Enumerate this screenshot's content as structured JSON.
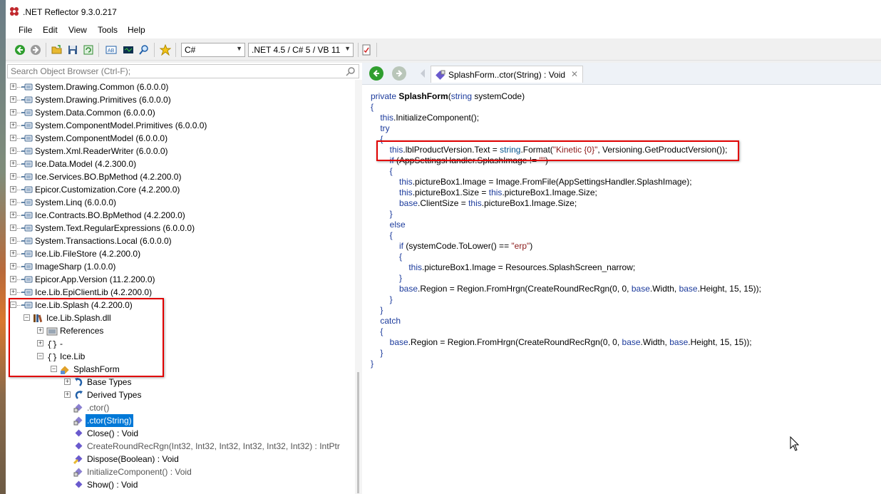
{
  "window": {
    "title": ".NET Reflector 9.3.0.217"
  },
  "menu": [
    "File",
    "Edit",
    "View",
    "Tools",
    "Help"
  ],
  "toolbar": {
    "language": "C#",
    "framework": ".NET 4.5 / C# 5 / VB 11",
    "icons": [
      "back-icon",
      "forward-icon",
      "open-icon",
      "save-icon",
      "refresh-icon",
      "analyzer-icon",
      "disassembler-icon",
      "search-icon",
      "bookmark-icon",
      "report-icon"
    ]
  },
  "search": {
    "placeholder": "Search Object Browser (Ctrl-F);"
  },
  "tree": [
    {
      "label": "System.Drawing.Common (6.0.0.0)",
      "level": 0,
      "icon": "assembly-icon",
      "expander": "+"
    },
    {
      "label": "System.Drawing.Primitives (6.0.0.0)",
      "level": 0,
      "icon": "assembly-icon",
      "expander": "+"
    },
    {
      "label": "System.Data.Common (6.0.0.0)",
      "level": 0,
      "icon": "assembly-icon",
      "expander": "+"
    },
    {
      "label": "System.ComponentModel.Primitives (6.0.0.0)",
      "level": 0,
      "icon": "assembly-icon",
      "expander": "+"
    },
    {
      "label": "System.ComponentModel (6.0.0.0)",
      "level": 0,
      "icon": "assembly-icon",
      "expander": "+"
    },
    {
      "label": "System.Xml.ReaderWriter (6.0.0.0)",
      "level": 0,
      "icon": "assembly-icon",
      "expander": "+"
    },
    {
      "label": "Ice.Data.Model (4.2.300.0)",
      "level": 0,
      "icon": "assembly-icon",
      "expander": "+"
    },
    {
      "label": "Ice.Services.BO.BpMethod (4.2.200.0)",
      "level": 0,
      "icon": "assembly-icon",
      "expander": "+"
    },
    {
      "label": "Epicor.Customization.Core (4.2.200.0)",
      "level": 0,
      "icon": "assembly-icon",
      "expander": "+"
    },
    {
      "label": "System.Linq (6.0.0.0)",
      "level": 0,
      "icon": "assembly-icon",
      "expander": "+"
    },
    {
      "label": "Ice.Contracts.BO.BpMethod (4.2.200.0)",
      "level": 0,
      "icon": "assembly-icon",
      "expander": "+"
    },
    {
      "label": "System.Text.RegularExpressions (6.0.0.0)",
      "level": 0,
      "icon": "assembly-icon",
      "expander": "+"
    },
    {
      "label": "System.Transactions.Local (6.0.0.0)",
      "level": 0,
      "icon": "assembly-icon",
      "expander": "+"
    },
    {
      "label": "Ice.Lib.FileStore (4.2.200.0)",
      "level": 0,
      "icon": "assembly-icon",
      "expander": "+"
    },
    {
      "label": "ImageSharp (1.0.0.0)",
      "level": 0,
      "icon": "assembly-icon",
      "expander": "+"
    },
    {
      "label": "Epicor.App.Version (11.2.200.0)",
      "level": 0,
      "icon": "assembly-icon",
      "expander": "+"
    },
    {
      "label": "Ice.Lib.EpiClientLib (4.2.200.0)",
      "level": 0,
      "icon": "assembly-icon",
      "expander": "+"
    },
    {
      "label": "Ice.Lib.Splash (4.2.200.0)",
      "level": 0,
      "icon": "assembly-icon",
      "expander": "-"
    },
    {
      "label": "Ice.Lib.Splash.dll",
      "level": 1,
      "icon": "module-icon",
      "expander": "-"
    },
    {
      "label": "References",
      "level": 2,
      "icon": "references-icon",
      "expander": "+"
    },
    {
      "label": "-",
      "level": 2,
      "icon": "namespace-icon",
      "expander": "+"
    },
    {
      "label": "Ice.Lib",
      "level": 2,
      "icon": "namespace-icon",
      "expander": "-"
    },
    {
      "label": "SplashForm",
      "level": 3,
      "icon": "class-icon",
      "expander": "-"
    },
    {
      "label": "Base Types",
      "level": 4,
      "icon": "base-types-icon",
      "expander": "+"
    },
    {
      "label": "Derived Types",
      "level": 4,
      "icon": "derived-types-icon",
      "expander": "+"
    },
    {
      "label": ".ctor()",
      "level": 4,
      "icon": "private-method-icon",
      "expander": "",
      "style": "gray"
    },
    {
      "label": ".ctor(String)",
      "level": 4,
      "icon": "private-method-icon",
      "expander": "",
      "style": "selected"
    },
    {
      "label": "Close() : Void",
      "level": 4,
      "icon": "method-icon",
      "expander": ""
    },
    {
      "label": "CreateRoundRecRgn(Int32, Int32, Int32, Int32, Int32, Int32) : IntPtr",
      "level": 4,
      "icon": "method-icon",
      "expander": "",
      "style": "gray"
    },
    {
      "label": "Dispose(Boolean) : Void",
      "level": 4,
      "icon": "protected-method-icon",
      "expander": ""
    },
    {
      "label": "InitializeComponent() : Void",
      "level": 4,
      "icon": "private-method-icon",
      "expander": "",
      "style": "gray"
    },
    {
      "label": "Show() : Void",
      "level": 4,
      "icon": "method-icon",
      "expander": ""
    }
  ],
  "document_tab": {
    "title": "SplashForm..ctor(String) : Void",
    "close": "✕"
  },
  "code_lines": [
    [
      [
        "kw",
        "private "
      ],
      [
        "bold",
        "SplashForm"
      ],
      [
        "",
        "("
      ],
      [
        "kw",
        "string"
      ],
      [
        "",
        " systemCode)"
      ]
    ],
    [
      [
        "kw",
        "{"
      ]
    ],
    [
      [
        "kw",
        "    this"
      ],
      [
        "",
        ".InitializeComponent();"
      ]
    ],
    [
      [
        "kw",
        "    try"
      ]
    ],
    [
      [
        "kw",
        "    {"
      ]
    ],
    [
      [
        "kw",
        "        this"
      ],
      [
        "",
        ".lblProductVersion.Text = "
      ],
      [
        "ty",
        "string"
      ],
      [
        "",
        ".Format("
      ],
      [
        "st",
        "\"Kinetic {0}\""
      ],
      [
        "",
        ", Versioning.GetProductVersion());"
      ]
    ],
    [
      [
        "kw",
        "        if"
      ],
      [
        "",
        " (AppSettingsHandler.SplashImage != "
      ],
      [
        "st",
        "\"\""
      ],
      [
        "",
        ")"
      ]
    ],
    [
      [
        "kw",
        "        {"
      ]
    ],
    [
      [
        "kw",
        "            this"
      ],
      [
        "",
        ".pictureBox1.Image = Image.FromFile(AppSettingsHandler.SplashImage);"
      ]
    ],
    [
      [
        "kw",
        "            this"
      ],
      [
        "",
        ".pictureBox1.Size = "
      ],
      [
        "kw",
        "this"
      ],
      [
        "",
        ".pictureBox1.Image.Size;"
      ]
    ],
    [
      [
        "kw",
        "            base"
      ],
      [
        "",
        ".ClientSize = "
      ],
      [
        "kw",
        "this"
      ],
      [
        "",
        ".pictureBox1.Image.Size;"
      ]
    ],
    [
      [
        "kw",
        "        }"
      ]
    ],
    [
      [
        "kw",
        "        else"
      ]
    ],
    [
      [
        "kw",
        "        {"
      ]
    ],
    [
      [
        "kw",
        "            if"
      ],
      [
        "",
        " (systemCode.ToLower() == "
      ],
      [
        "st",
        "\"erp\""
      ],
      [
        "",
        ")"
      ]
    ],
    [
      [
        "kw",
        "            {"
      ]
    ],
    [
      [
        "kw",
        "                this"
      ],
      [
        "",
        ".pictureBox1.Image = Resources.SplashScreen_narrow;"
      ]
    ],
    [
      [
        "kw",
        "            }"
      ]
    ],
    [
      [
        "kw",
        "            base"
      ],
      [
        "",
        ".Region = Region.FromHrgn(CreateRoundRecRgn(0, 0, "
      ],
      [
        "kw",
        "base"
      ],
      [
        "",
        ".Width, "
      ],
      [
        "kw",
        "base"
      ],
      [
        "",
        ".Height, 15, 15));"
      ]
    ],
    [
      [
        "kw",
        "        }"
      ]
    ],
    [
      [
        "kw",
        "    }"
      ]
    ],
    [
      [
        "kw",
        "    catch"
      ]
    ],
    [
      [
        "kw",
        "    {"
      ]
    ],
    [
      [
        "kw",
        "        base"
      ],
      [
        "",
        ".Region = Region.FromHrgn(CreateRoundRecRgn(0, 0, "
      ],
      [
        "kw",
        "base"
      ],
      [
        "",
        ".Width, "
      ],
      [
        "kw",
        "base"
      ],
      [
        "",
        ".Height, 15, 15));"
      ]
    ],
    [
      [
        "kw",
        "    }"
      ]
    ],
    [
      [
        "kw",
        "}"
      ]
    ]
  ]
}
